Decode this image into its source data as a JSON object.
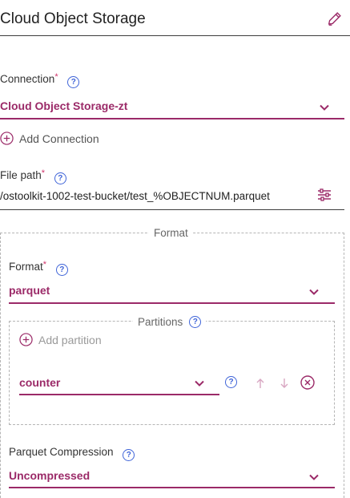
{
  "header": {
    "title": "Cloud Object Storage"
  },
  "connection": {
    "label": "Connection",
    "required_mark": "*",
    "value": "Cloud Object Storage-zt",
    "add_label": "Add Connection"
  },
  "file_path": {
    "label": "File path",
    "required_mark": "*",
    "value": "/ostoolkit-1002-test-bucket/test_%OBJECTNUM.parquet"
  },
  "format_section": {
    "legend": "Format",
    "format": {
      "label": "Format",
      "required_mark": "*",
      "value": "parquet"
    },
    "partitions": {
      "legend": "Partitions",
      "add_label": "Add partition",
      "items": [
        {
          "value": "counter"
        }
      ]
    },
    "compression": {
      "label": "Parquet Compression",
      "value": "Uncompressed"
    }
  },
  "colors": {
    "accent": "#9b2a68",
    "help": "#3f64d8",
    "required": "#d1346b"
  }
}
